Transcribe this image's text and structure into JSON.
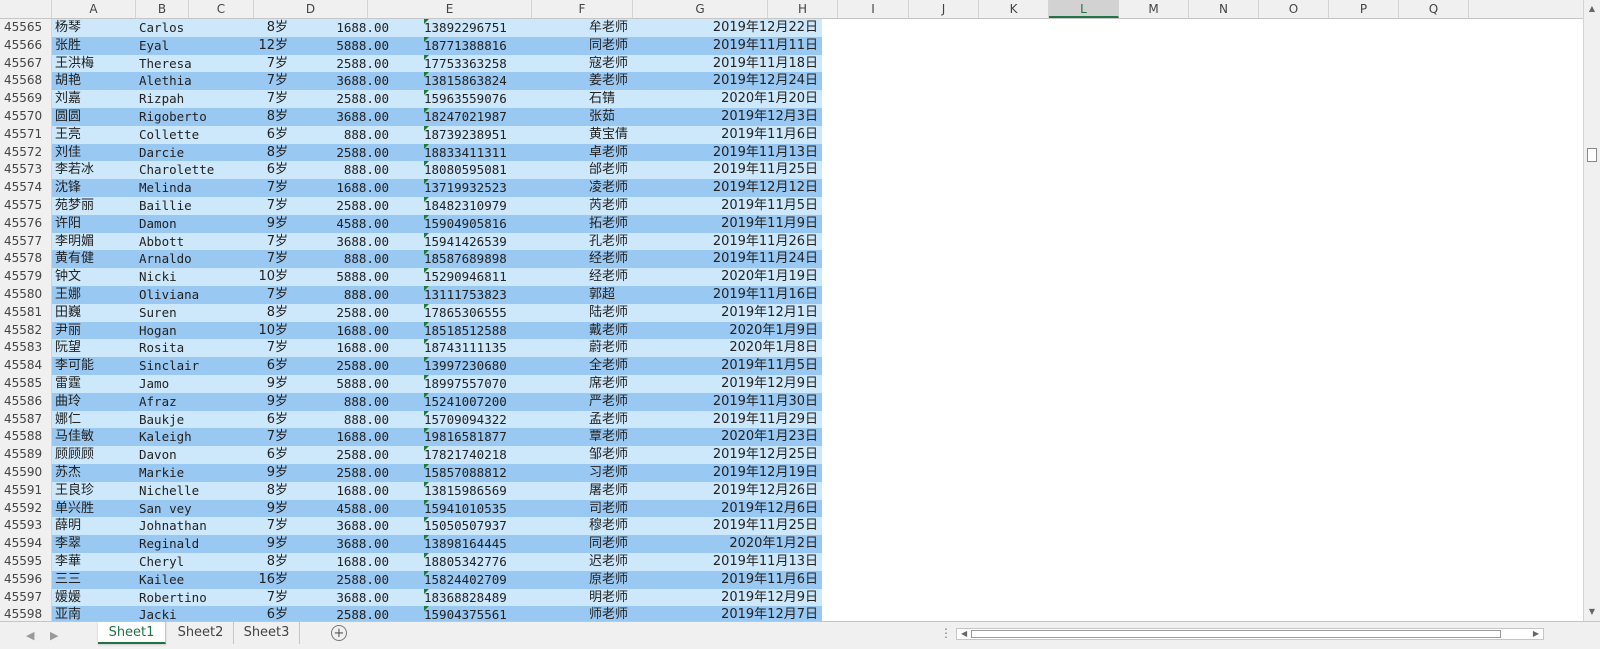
{
  "columns": [
    "A",
    "B",
    "C",
    "D",
    "E",
    "F",
    "G",
    "H",
    "I",
    "J",
    "K",
    "L",
    "M",
    "N",
    "O",
    "P",
    "Q"
  ],
  "selected_column": "L",
  "rows": [
    {
      "n": "45565",
      "a": "杨琴",
      "b": "Carlos",
      "c": "8岁",
      "d": "1688.00",
      "e": "13892296751",
      "f": "牟老师",
      "g": "2019年12月22日"
    },
    {
      "n": "45566",
      "a": "张胜",
      "b": "Eyal",
      "c": "12岁",
      "d": "5888.00",
      "e": "18771388816",
      "f": "同老师",
      "g": "2019年11月11日"
    },
    {
      "n": "45567",
      "a": "王洪梅",
      "b": "Theresa",
      "c": "7岁",
      "d": "2588.00",
      "e": "17753363258",
      "f": "寇老师",
      "g": "2019年11月18日"
    },
    {
      "n": "45568",
      "a": "胡艳",
      "b": "Alethia",
      "c": "7岁",
      "d": "3688.00",
      "e": "13815863824",
      "f": "姜老师",
      "g": "2019年12月24日"
    },
    {
      "n": "45569",
      "a": "刘嘉",
      "b": "Rizpah",
      "c": "7岁",
      "d": "2588.00",
      "e": "15963559076",
      "f": "石锖",
      "g": "2020年1月20日"
    },
    {
      "n": "45570",
      "a": "圆圆",
      "b": "Rigoberto",
      "c": "8岁",
      "d": "3688.00",
      "e": "18247021987",
      "f": "张茹",
      "g": "2019年12月3日"
    },
    {
      "n": "45571",
      "a": "王亮",
      "b": "Collette",
      "c": "6岁",
      "d": "888.00",
      "e": "18739238951",
      "f": "黄宝倩",
      "g": "2019年11月6日"
    },
    {
      "n": "45572",
      "a": "刘佳",
      "b": "Darcie",
      "c": "8岁",
      "d": "2588.00",
      "e": "18833411311",
      "f": "卓老师",
      "g": "2019年11月13日"
    },
    {
      "n": "45573",
      "a": "李若冰",
      "b": "Charolette",
      "c": "6岁",
      "d": "888.00",
      "e": "18080595081",
      "f": "邰老师",
      "g": "2019年11月25日"
    },
    {
      "n": "45574",
      "a": "沈锋",
      "b": "Melinda",
      "c": "7岁",
      "d": "1688.00",
      "e": "13719932523",
      "f": "凌老师",
      "g": "2019年12月12日"
    },
    {
      "n": "45575",
      "a": "苑梦丽",
      "b": "Baillie",
      "c": "7岁",
      "d": "2588.00",
      "e": "18482310979",
      "f": "芮老师",
      "g": "2019年11月5日"
    },
    {
      "n": "45576",
      "a": "许阳",
      "b": "Damon",
      "c": "9岁",
      "d": "4588.00",
      "e": "15904905816",
      "f": "拓老师",
      "g": "2019年11月9日"
    },
    {
      "n": "45577",
      "a": "李明媚",
      "b": "Abbott",
      "c": "7岁",
      "d": "3688.00",
      "e": "15941426539",
      "f": "孔老师",
      "g": "2019年11月26日"
    },
    {
      "n": "45578",
      "a": "黄有健",
      "b": "Arnaldo",
      "c": "7岁",
      "d": "888.00",
      "e": "18587689898",
      "f": "经老师",
      "g": "2019年11月24日"
    },
    {
      "n": "45579",
      "a": "钟文",
      "b": "Nicki",
      "c": "10岁",
      "d": "5888.00",
      "e": "15290946811",
      "f": "经老师",
      "g": "2020年1月19日"
    },
    {
      "n": "45580",
      "a": "王娜",
      "b": "Oliviana",
      "c": "7岁",
      "d": "888.00",
      "e": "13111753823",
      "f": "郭超",
      "g": "2019年11月16日"
    },
    {
      "n": "45581",
      "a": "田巍",
      "b": "Suren",
      "c": "8岁",
      "d": "2588.00",
      "e": "17865306555",
      "f": "陆老师",
      "g": "2019年12月1日"
    },
    {
      "n": "45582",
      "a": "尹丽",
      "b": "Hogan",
      "c": "10岁",
      "d": "1688.00",
      "e": "18518512588",
      "f": "戴老师",
      "g": "2020年1月9日"
    },
    {
      "n": "45583",
      "a": "阮望",
      "b": "Rosita",
      "c": "7岁",
      "d": "1688.00",
      "e": "18743111135",
      "f": "蔚老师",
      "g": "2020年1月8日"
    },
    {
      "n": "45584",
      "a": "李可能",
      "b": "Sinclair",
      "c": "6岁",
      "d": "2588.00",
      "e": "13997230680",
      "f": "全老师",
      "g": "2019年11月5日"
    },
    {
      "n": "45585",
      "a": "雷霆",
      "b": "Jamo",
      "c": "9岁",
      "d": "5888.00",
      "e": "18997557070",
      "f": "席老师",
      "g": "2019年12月9日"
    },
    {
      "n": "45586",
      "a": "曲玲",
      "b": "Afraz",
      "c": "9岁",
      "d": "888.00",
      "e": "15241007200",
      "f": "严老师",
      "g": "2019年11月30日"
    },
    {
      "n": "45587",
      "a": "娜仁",
      "b": "Baukje",
      "c": "6岁",
      "d": "888.00",
      "e": "15709094322",
      "f": "孟老师",
      "g": "2019年11月29日"
    },
    {
      "n": "45588",
      "a": "马佳敏",
      "b": "Kaleigh",
      "c": "7岁",
      "d": "1688.00",
      "e": "19816581877",
      "f": "覃老师",
      "g": "2020年1月23日"
    },
    {
      "n": "45589",
      "a": "顾顾顾",
      "b": "Davon",
      "c": "6岁",
      "d": "2588.00",
      "e": "17821740218",
      "f": "邹老师",
      "g": "2019年12月25日"
    },
    {
      "n": "45590",
      "a": "苏杰",
      "b": "Markie",
      "c": "9岁",
      "d": "2588.00",
      "e": "15857088812",
      "f": "习老师",
      "g": "2019年12月19日"
    },
    {
      "n": "45591",
      "a": "王良珍",
      "b": "Nichelle",
      "c": "8岁",
      "d": "1688.00",
      "e": "13815986569",
      "f": "屠老师",
      "g": "2019年12月26日"
    },
    {
      "n": "45592",
      "a": "单兴胜",
      "b": "San vey",
      "c": "9岁",
      "d": "4588.00",
      "e": "15941010535",
      "f": "司老师",
      "g": "2019年12月6日"
    },
    {
      "n": "45593",
      "a": "薛明",
      "b": "Johnathan",
      "c": "7岁",
      "d": "3688.00",
      "e": "15050507937",
      "f": "穆老师",
      "g": "2019年11月25日"
    },
    {
      "n": "45594",
      "a": "李翠",
      "b": "Reginald",
      "c": "9岁",
      "d": "3688.00",
      "e": "13898164445",
      "f": "同老师",
      "g": "2020年1月2日"
    },
    {
      "n": "45595",
      "a": "李華",
      "b": "Cheryl",
      "c": "8岁",
      "d": "1688.00",
      "e": "18805342776",
      "f": "迟老师",
      "g": "2019年11月13日"
    },
    {
      "n": "45596",
      "a": "三三",
      "b": "Kailee",
      "c": "16岁",
      "d": "2588.00",
      "e": "15824402709",
      "f": "原老师",
      "g": "2019年11月6日"
    },
    {
      "n": "45597",
      "a": "媛媛",
      "b": "Robertino",
      "c": "7岁",
      "d": "3688.00",
      "e": "18368828489",
      "f": "明老师",
      "g": "2019年12月9日"
    },
    {
      "n": "45598",
      "a": "亚南",
      "b": "Jacki",
      "c": "6岁",
      "d": "2588.00",
      "e": "15904375561",
      "f": "师老师",
      "g": "2019年12月7日"
    }
  ],
  "sheets": [
    "Sheet1",
    "Sheet2",
    "Sheet3"
  ],
  "active_sheet": "Sheet1",
  "add_sheet_symbol": "+",
  "nav": {
    "prev": "◀",
    "next": "▶",
    "dots": "⋮"
  }
}
